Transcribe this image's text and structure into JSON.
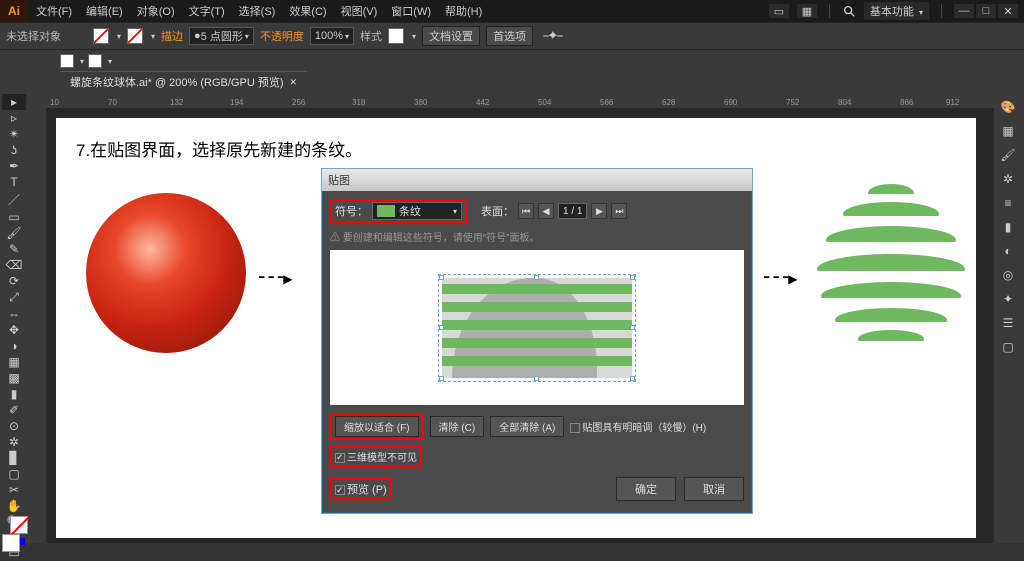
{
  "titlebar": {
    "logo": "Ai",
    "menus": [
      "文件(F)",
      "编辑(E)",
      "对象(O)",
      "文字(T)",
      "选择(S)",
      "效果(C)",
      "视图(V)",
      "窗口(W)",
      "帮助(H)"
    ],
    "basic_func": "基本功能"
  },
  "options": {
    "no_selection": "未选择对象",
    "stroke_label": "描边",
    "stroke_val": "5 点圆形",
    "opacity_label": "不透明度",
    "opacity_val": "100%",
    "style_label": "样式",
    "doc_setup": "文档设置",
    "prefs": "首选项"
  },
  "tab": {
    "name": "螺旋条纹球体.ai* @ 200% (RGB/GPU 预览)"
  },
  "ruler_marks": [
    "10",
    "70",
    "132",
    "194",
    "256",
    "318",
    "380",
    "442",
    "504",
    "566",
    "628",
    "690",
    "752",
    "804",
    "866",
    "912"
  ],
  "instruction": "7.在贴图界面，选择原先新建的条纹。",
  "arrow_glyph": "- - -",
  "dialog": {
    "title": "贴图",
    "symbol_label": "符号：",
    "symbol_value": "条纹",
    "surface_label": "表面：",
    "page": "1 / 1",
    "hint": "要创建和编辑这些符号，请使用“符号”面板。",
    "scale_fit": "缩放以适合 (F)",
    "clear": "清除 (C)",
    "clear_all": "全部清除 (A)",
    "shade": "贴图具有明暗调（较慢）(H)",
    "invisible": "三维模型不可见",
    "preview": "预览 (P)",
    "ok": "确定",
    "cancel": "取消"
  }
}
